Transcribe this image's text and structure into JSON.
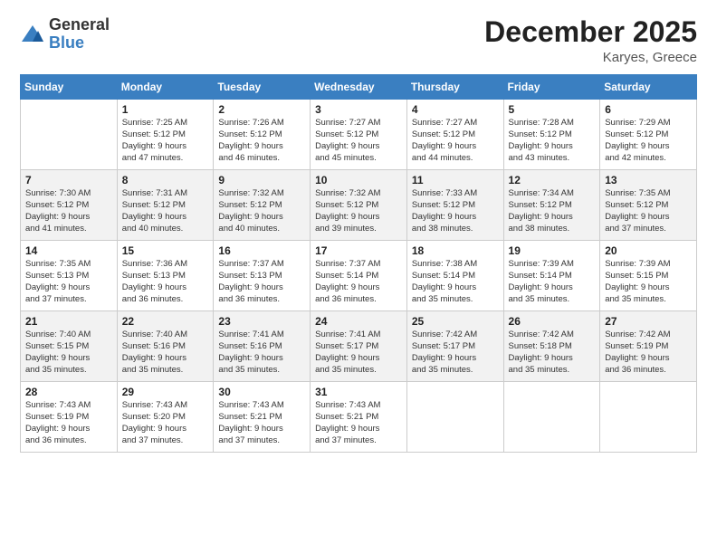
{
  "logo": {
    "general": "General",
    "blue": "Blue"
  },
  "title": "December 2025",
  "location": "Karyes, Greece",
  "days_header": [
    "Sunday",
    "Monday",
    "Tuesday",
    "Wednesday",
    "Thursday",
    "Friday",
    "Saturday"
  ],
  "weeks": [
    [
      {
        "num": "",
        "info": ""
      },
      {
        "num": "1",
        "info": "Sunrise: 7:25 AM\nSunset: 5:12 PM\nDaylight: 9 hours\nand 47 minutes."
      },
      {
        "num": "2",
        "info": "Sunrise: 7:26 AM\nSunset: 5:12 PM\nDaylight: 9 hours\nand 46 minutes."
      },
      {
        "num": "3",
        "info": "Sunrise: 7:27 AM\nSunset: 5:12 PM\nDaylight: 9 hours\nand 45 minutes."
      },
      {
        "num": "4",
        "info": "Sunrise: 7:27 AM\nSunset: 5:12 PM\nDaylight: 9 hours\nand 44 minutes."
      },
      {
        "num": "5",
        "info": "Sunrise: 7:28 AM\nSunset: 5:12 PM\nDaylight: 9 hours\nand 43 minutes."
      },
      {
        "num": "6",
        "info": "Sunrise: 7:29 AM\nSunset: 5:12 PM\nDaylight: 9 hours\nand 42 minutes."
      }
    ],
    [
      {
        "num": "7",
        "info": "Sunrise: 7:30 AM\nSunset: 5:12 PM\nDaylight: 9 hours\nand 41 minutes."
      },
      {
        "num": "8",
        "info": "Sunrise: 7:31 AM\nSunset: 5:12 PM\nDaylight: 9 hours\nand 40 minutes."
      },
      {
        "num": "9",
        "info": "Sunrise: 7:32 AM\nSunset: 5:12 PM\nDaylight: 9 hours\nand 40 minutes."
      },
      {
        "num": "10",
        "info": "Sunrise: 7:32 AM\nSunset: 5:12 PM\nDaylight: 9 hours\nand 39 minutes."
      },
      {
        "num": "11",
        "info": "Sunrise: 7:33 AM\nSunset: 5:12 PM\nDaylight: 9 hours\nand 38 minutes."
      },
      {
        "num": "12",
        "info": "Sunrise: 7:34 AM\nSunset: 5:12 PM\nDaylight: 9 hours\nand 38 minutes."
      },
      {
        "num": "13",
        "info": "Sunrise: 7:35 AM\nSunset: 5:12 PM\nDaylight: 9 hours\nand 37 minutes."
      }
    ],
    [
      {
        "num": "14",
        "info": "Sunrise: 7:35 AM\nSunset: 5:13 PM\nDaylight: 9 hours\nand 37 minutes."
      },
      {
        "num": "15",
        "info": "Sunrise: 7:36 AM\nSunset: 5:13 PM\nDaylight: 9 hours\nand 36 minutes."
      },
      {
        "num": "16",
        "info": "Sunrise: 7:37 AM\nSunset: 5:13 PM\nDaylight: 9 hours\nand 36 minutes."
      },
      {
        "num": "17",
        "info": "Sunrise: 7:37 AM\nSunset: 5:14 PM\nDaylight: 9 hours\nand 36 minutes."
      },
      {
        "num": "18",
        "info": "Sunrise: 7:38 AM\nSunset: 5:14 PM\nDaylight: 9 hours\nand 35 minutes."
      },
      {
        "num": "19",
        "info": "Sunrise: 7:39 AM\nSunset: 5:14 PM\nDaylight: 9 hours\nand 35 minutes."
      },
      {
        "num": "20",
        "info": "Sunrise: 7:39 AM\nSunset: 5:15 PM\nDaylight: 9 hours\nand 35 minutes."
      }
    ],
    [
      {
        "num": "21",
        "info": "Sunrise: 7:40 AM\nSunset: 5:15 PM\nDaylight: 9 hours\nand 35 minutes."
      },
      {
        "num": "22",
        "info": "Sunrise: 7:40 AM\nSunset: 5:16 PM\nDaylight: 9 hours\nand 35 minutes."
      },
      {
        "num": "23",
        "info": "Sunrise: 7:41 AM\nSunset: 5:16 PM\nDaylight: 9 hours\nand 35 minutes."
      },
      {
        "num": "24",
        "info": "Sunrise: 7:41 AM\nSunset: 5:17 PM\nDaylight: 9 hours\nand 35 minutes."
      },
      {
        "num": "25",
        "info": "Sunrise: 7:42 AM\nSunset: 5:17 PM\nDaylight: 9 hours\nand 35 minutes."
      },
      {
        "num": "26",
        "info": "Sunrise: 7:42 AM\nSunset: 5:18 PM\nDaylight: 9 hours\nand 35 minutes."
      },
      {
        "num": "27",
        "info": "Sunrise: 7:42 AM\nSunset: 5:19 PM\nDaylight: 9 hours\nand 36 minutes."
      }
    ],
    [
      {
        "num": "28",
        "info": "Sunrise: 7:43 AM\nSunset: 5:19 PM\nDaylight: 9 hours\nand 36 minutes."
      },
      {
        "num": "29",
        "info": "Sunrise: 7:43 AM\nSunset: 5:20 PM\nDaylight: 9 hours\nand 37 minutes."
      },
      {
        "num": "30",
        "info": "Sunrise: 7:43 AM\nSunset: 5:21 PM\nDaylight: 9 hours\nand 37 minutes."
      },
      {
        "num": "31",
        "info": "Sunrise: 7:43 AM\nSunset: 5:21 PM\nDaylight: 9 hours\nand 37 minutes."
      },
      {
        "num": "",
        "info": ""
      },
      {
        "num": "",
        "info": ""
      },
      {
        "num": "",
        "info": ""
      }
    ]
  ]
}
